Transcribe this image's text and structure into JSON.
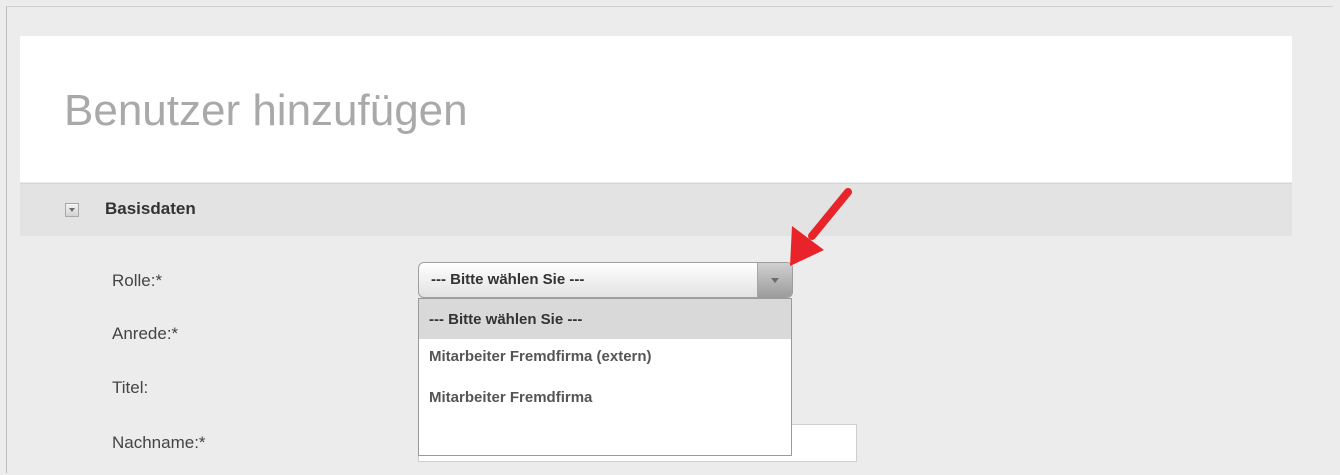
{
  "page": {
    "title": "Benutzer hinzufügen"
  },
  "section": {
    "title": "Basisdaten",
    "expanded": true
  },
  "form": {
    "labels": {
      "rolle": "Rolle:*",
      "anrede": "Anrede:*",
      "titel": "Titel:",
      "nachname": "Nachname:*"
    },
    "rolle_select": {
      "value": "--- Bitte wählen Sie ---",
      "options": [
        "--- Bitte wählen Sie ---",
        "Mitarbeiter Fremdfirma (extern)",
        "Mitarbeiter Fremdfirma"
      ],
      "open": true
    },
    "nachname_input": {
      "value": ""
    }
  },
  "colors": {
    "annotation_arrow": "#e8242a",
    "title_text": "#a9a9a9",
    "section_bar": "#e3e3e3",
    "selected_option_bg": "#d9d9d9"
  }
}
